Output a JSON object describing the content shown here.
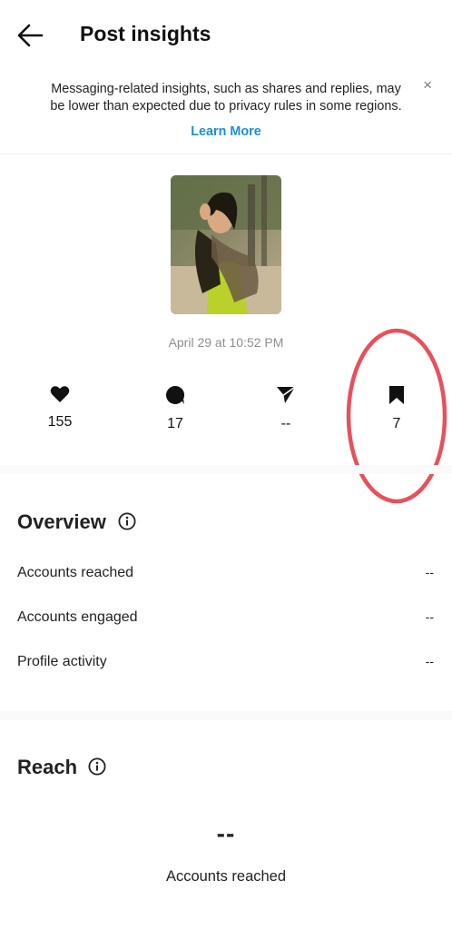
{
  "header": {
    "title": "Post insights",
    "back_icon": "arrow-left-icon"
  },
  "notice": {
    "text": "Messaging-related insights, such as shares and replies, may be lower than expected due to privacy rules in some regions.",
    "close_label": "×",
    "link_label": "Learn More",
    "link_color": "#1a8fd6"
  },
  "post": {
    "thumbnail_icon": "post-thumbnail-photo",
    "date": "April 29 at 10:52 PM"
  },
  "stats": [
    {
      "icon": "heart-icon",
      "value": "155"
    },
    {
      "icon": "comment-icon",
      "value": "17"
    },
    {
      "icon": "share-icon",
      "value": "--"
    },
    {
      "icon": "bookmark-icon",
      "value": "7"
    }
  ],
  "annotation": {
    "color": "#e8505b",
    "shape": "ellipse-around-saves"
  },
  "overview": {
    "title": "Overview",
    "rows": [
      {
        "label": "Accounts reached",
        "value": "--"
      },
      {
        "label": "Accounts engaged",
        "value": "--"
      },
      {
        "label": "Profile activity",
        "value": "--"
      }
    ]
  },
  "reach": {
    "title": "Reach",
    "value": "--",
    "caption": "Accounts reached"
  }
}
